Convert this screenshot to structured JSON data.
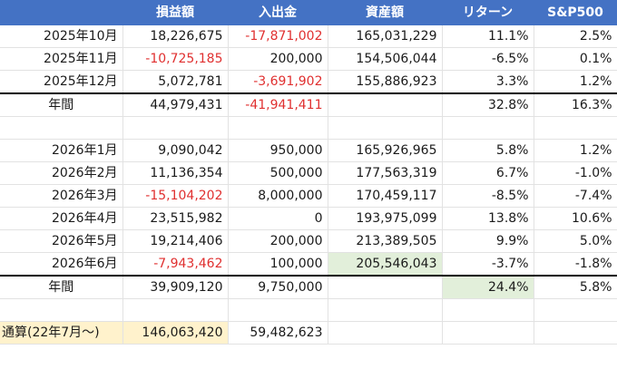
{
  "headers": [
    "",
    "損益額",
    "入出金",
    "資産額",
    "リターン",
    "S&P500"
  ],
  "rows_2025": [
    {
      "month": "2025年10月",
      "pl": "18,226,675",
      "flow": "-17,871,002",
      "assets": "165,031,229",
      "ret": "11.1%",
      "sp": "2.5%"
    },
    {
      "month": "2025年11月",
      "pl": "-10,725,185",
      "flow": "200,000",
      "assets": "154,506,044",
      "ret": "-6.5%",
      "sp": "0.1%"
    },
    {
      "month": "2025年12月",
      "pl": "5,072,781",
      "flow": "-3,691,902",
      "assets": "155,886,923",
      "ret": "3.3%",
      "sp": "1.2%"
    }
  ],
  "annual_2025": {
    "label": "年間",
    "pl": "44,979,431",
    "flow": "-41,941,411",
    "ret": "32.8%",
    "sp": "16.3%"
  },
  "rows_2026": [
    {
      "month": "2026年1月",
      "pl": "9,090,042",
      "flow": "950,000",
      "assets": "165,926,965",
      "ret": "5.8%",
      "sp": "1.2%"
    },
    {
      "month": "2026年2月",
      "pl": "11,136,354",
      "flow": "500,000",
      "assets": "177,563,319",
      "ret": "6.7%",
      "sp": "-1.0%"
    },
    {
      "month": "2026年3月",
      "pl": "-15,104,202",
      "flow": "8,000,000",
      "assets": "170,459,117",
      "ret": "-8.5%",
      "sp": "-7.4%"
    },
    {
      "month": "2026年4月",
      "pl": "23,515,982",
      "flow": "0",
      "assets": "193,975,099",
      "ret": "13.8%",
      "sp": "10.6%"
    },
    {
      "month": "2026年5月",
      "pl": "19,214,406",
      "flow": "200,000",
      "assets": "213,389,505",
      "ret": "9.9%",
      "sp": "5.0%"
    },
    {
      "month": "2026年6月",
      "pl": "-7,943,462",
      "flow": "100,000",
      "assets": "205,546,043",
      "ret": "-3.7%",
      "sp": "-1.8%"
    }
  ],
  "annual_2026": {
    "label": "年間",
    "pl": "39,909,120",
    "flow": "9,750,000",
    "ret": "24.4%",
    "sp": "5.8%"
  },
  "cumulative": {
    "label": "通算(22年7月～)",
    "pl": "146,063,420",
    "flow": "59,482,623"
  },
  "colors": {
    "header_bg": "#4472c4",
    "negative": "#e03030",
    "highlight_green": "#e2efda",
    "highlight_yellow": "#fff2cc"
  }
}
